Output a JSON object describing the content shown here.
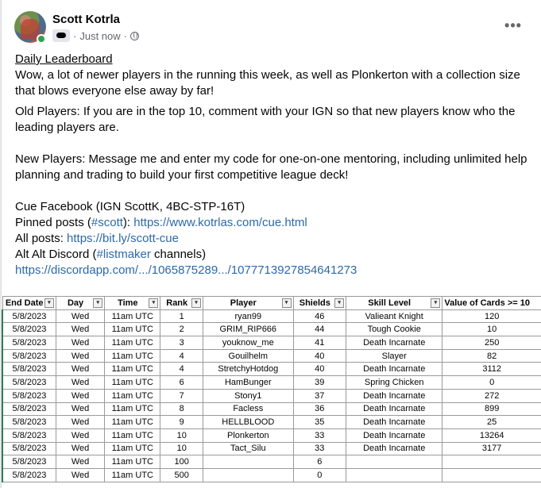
{
  "post": {
    "author": "Scott Kotrla",
    "timestamp": "Just now",
    "separator": "·",
    "more_label": "•••",
    "icons": {
      "badge": "gamepad-icon",
      "audience": "globe-icon",
      "more": "more-dots-icon"
    },
    "lines": {
      "title": "Daily Leaderboard",
      "intro1": "Wow, a lot of newer players in the running this week, as well as Plonkerton with a collection size",
      "intro2": "that blows everyone else away by far!",
      "old1": "Old Players: If you are in the top 10, comment with your IGN so that new players know who the",
      "old2": "leading players are.",
      "new1": "New Players: Message me and enter my code for one-on-one mentoring, including unlimited help",
      "new2": "planning and trading to build your first competitive league deck!",
      "cue": "Cue Facebook (IGN ScottK, 4BC-STP-16T)",
      "pinned_prefix": "Pinned posts (",
      "pinned_tag": "#scott",
      "pinned_mid": "): ",
      "pinned_url": "https://www.kotrlas.com/cue.html",
      "all_prefix": "All posts: ",
      "all_url": "https://bit.ly/scott-cue",
      "discord_prefix": "Alt Alt Discord (",
      "discord_tag": "#listmaker",
      "discord_suffix": " channels)",
      "discord_url": "https://discordapp.com/.../1065875289.../1077713927854641273"
    },
    "link_color": "#2d69a8"
  },
  "table": {
    "headers": [
      "End Date",
      "Day",
      "Time",
      "Rank",
      "Player",
      "Shields",
      "Skill Level",
      "Value of Cards >= 10"
    ],
    "rows": [
      [
        "5/8/2023",
        "Wed",
        "11am UTC",
        "1",
        "ryan99",
        "46",
        "Valieant Knight",
        "120"
      ],
      [
        "5/8/2023",
        "Wed",
        "11am UTC",
        "2",
        "GRIM_RIP666",
        "44",
        "Tough Cookie",
        "10"
      ],
      [
        "5/8/2023",
        "Wed",
        "11am UTC",
        "3",
        "youknow_me",
        "41",
        "Death Incarnate",
        "250"
      ],
      [
        "5/8/2023",
        "Wed",
        "11am UTC",
        "4",
        "Gouilhelm",
        "40",
        "Slayer",
        "82"
      ],
      [
        "5/8/2023",
        "Wed",
        "11am UTC",
        "4",
        "StretchyHotdog",
        "40",
        "Death Incarnate",
        "3112"
      ],
      [
        "5/8/2023",
        "Wed",
        "11am UTC",
        "6",
        "HamBunger",
        "39",
        "Spring Chicken",
        "0"
      ],
      [
        "5/8/2023",
        "Wed",
        "11am UTC",
        "7",
        "Stony1",
        "37",
        "Death Incarnate",
        "272"
      ],
      [
        "5/8/2023",
        "Wed",
        "11am UTC",
        "8",
        "Facless",
        "36",
        "Death Incarnate",
        "899"
      ],
      [
        "5/8/2023",
        "Wed",
        "11am UTC",
        "9",
        "HELLBLOOD",
        "35",
        "Death Incarnate",
        "25"
      ],
      [
        "5/8/2023",
        "Wed",
        "11am UTC",
        "10",
        "Plonkerton",
        "33",
        "Death Incarnate",
        "13264"
      ],
      [
        "5/8/2023",
        "Wed",
        "11am UTC",
        "10",
        "Tact_Silu",
        "33",
        "Death Incarnate",
        "3177"
      ],
      [
        "5/8/2023",
        "Wed",
        "11am UTC",
        "100",
        "",
        "6",
        "",
        ""
      ],
      [
        "5/8/2023",
        "Wed",
        "11am UTC",
        "500",
        "",
        "0",
        "",
        ""
      ]
    ]
  }
}
